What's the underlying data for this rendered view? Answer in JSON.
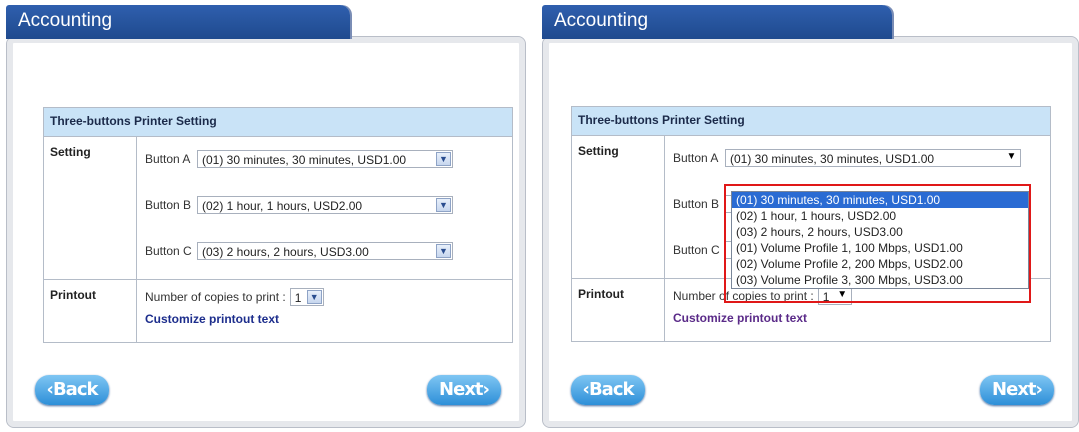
{
  "left": {
    "tab_title": "Accounting",
    "table_title": "Three-buttons Printer Setting",
    "setting_label": "Setting",
    "button_a_label": "Button A",
    "button_a_value": "(01) 30 minutes, 30 minutes, USD1.00",
    "button_b_label": "Button B",
    "button_b_value": "(02) 1 hour, 1 hours, USD2.00",
    "button_c_label": "Button C",
    "button_c_value": "(03) 2 hours, 2 hours, USD3.00",
    "printout_label": "Printout",
    "copies_label": "Number of copies to print :",
    "copies_value": "1",
    "customize_link": "Customize printout text",
    "back_label": "‹Back",
    "next_label": "Next›"
  },
  "right": {
    "tab_title": "Accounting",
    "table_title": "Three-buttons Printer Setting",
    "setting_label": "Setting",
    "button_a_label": "Button A",
    "button_a_value": "(01) 30 minutes, 30 minutes, USD1.00",
    "button_b_label": "Button B",
    "button_c_label": "Button C",
    "printout_label": "Printout",
    "copies_label": "Number of copies to print :",
    "copies_value": "1",
    "customize_link": "Customize printout text",
    "back_label": "‹Back",
    "next_label": "Next›",
    "dropdown_options": [
      "(01) 30 minutes, 30 minutes, USD1.00",
      "(02) 1 hour, 1 hours, USD2.00",
      "(03) 2 hours, 2 hours, USD3.00",
      "(01) Volume Profile 1, 100 Mbps, USD1.00",
      "(02) Volume Profile 2, 200 Mbps, USD2.00",
      "(03) Volume Profile 3, 300 Mbps, USD3.00"
    ]
  },
  "colors": {
    "tab": "#1f4a8e",
    "table_header": "#c9e3f7",
    "link": "#1c2d8c",
    "highlight": "#e01818",
    "selected_option": "#2a6bd3"
  }
}
